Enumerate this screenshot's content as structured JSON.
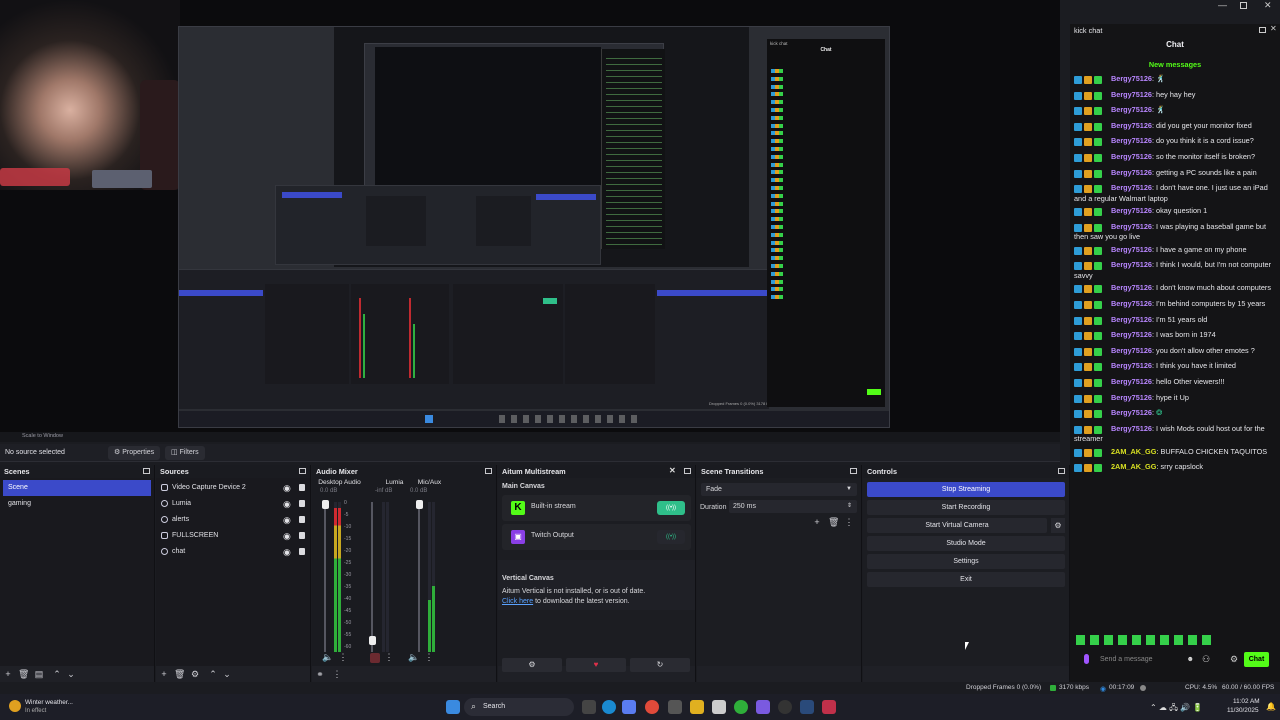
{
  "preview": {
    "scale_label": "Scale to Window",
    "nested_chat_title": "Chat",
    "nested_chat_header": "kick chat",
    "nested_status": "Dropped Frames 0 (0.0%)  3178 kbps  00:10:15  CPU 4.5%  60.00 / 60.00 FPS"
  },
  "propbar": {
    "no_source": "No source selected",
    "properties_label": "Properties",
    "filters_label": "Filters"
  },
  "scenes": {
    "title": "Scenes",
    "items": [
      {
        "label": "Scene",
        "selected": true
      },
      {
        "label": "gaming",
        "selected": false
      }
    ]
  },
  "sources": {
    "title": "Sources",
    "items": [
      {
        "label": "Video Capture Device 2"
      },
      {
        "label": "Lumia"
      },
      {
        "label": "alerts"
      },
      {
        "label": "FULLSCREEN"
      },
      {
        "label": "chat"
      }
    ]
  },
  "mixer": {
    "title": "Audio Mixer",
    "channels": [
      {
        "name": "Desktop Audio",
        "db": "0.0 dB",
        "level": 0.96,
        "level2": 0.96
      },
      {
        "name": "Lumia",
        "db": "-inf dB",
        "level": 0.0,
        "level2": 0.0
      },
      {
        "name": "Mic/Aux",
        "db": "0.0 dB",
        "level": 0.35,
        "level2": 0.44
      }
    ],
    "ticks": [
      "0",
      "-5",
      "-10",
      "-15",
      "-20",
      "-25",
      "-30",
      "-35",
      "-40",
      "-45",
      "-50",
      "-55",
      "-60"
    ]
  },
  "aitum": {
    "title": "Aitum Multistream",
    "main_canvas": "Main Canvas",
    "outputs": [
      {
        "label": "Built-in stream",
        "active": true
      },
      {
        "label": "Twitch Output",
        "active": false
      }
    ],
    "vertical_title": "Vertical Canvas",
    "vertical_text": "Aitum Vertical is not installed, or is out of date.",
    "vertical_link": "Click here",
    "vertical_link_rest": " to download the latest version."
  },
  "transitions": {
    "title": "Scene Transitions",
    "selected": "Fade",
    "duration_label": "Duration",
    "duration_value": "250 ms"
  },
  "controls": {
    "title": "Controls",
    "buttons": [
      {
        "label": "Stop Streaming",
        "active": true
      },
      {
        "label": "Start Recording",
        "active": false
      },
      {
        "label": "Start Virtual Camera",
        "active": false
      },
      {
        "label": "Studio Mode",
        "active": false
      },
      {
        "label": "Settings",
        "active": false
      },
      {
        "label": "Exit",
        "active": false
      }
    ]
  },
  "status": {
    "dropped": "Dropped Frames 0 (0.0%)",
    "kbps": "3170 kbps",
    "time": "00:17:09",
    "cpu": "CPU: 4.5%",
    "fps": "60.00 / 60.00 FPS"
  },
  "kick": {
    "window_title": "kick chat",
    "chat_title": "Chat",
    "new_messages": "New messages",
    "input_placeholder": "Send a message",
    "send_label": "Chat",
    "messages": [
      {
        "user": "Bergy75126",
        "text": "",
        "emoji": true,
        "green": false
      },
      {
        "user": "Bergy75126",
        "text": "hey hay hey",
        "green": false
      },
      {
        "user": "Bergy75126",
        "text": "",
        "emoji": true,
        "green": false
      },
      {
        "user": "Bergy75126",
        "text": "did you get your monitor fixed",
        "green": false
      },
      {
        "user": "Bergy75126",
        "text": "do you think it is a cord issue?",
        "green": false
      },
      {
        "user": "Bergy75126",
        "text": "so the monitor itself is broken?",
        "green": false
      },
      {
        "user": "Bergy75126",
        "text": "getting a PC sounds like a pain",
        "green": false
      },
      {
        "user": "Bergy75126",
        "text": "I don't have one. I just use an iPad and a regular Walmart laptop",
        "green": false
      },
      {
        "user": "Bergy75126",
        "text": "okay question 1",
        "green": false
      },
      {
        "user": "Bergy75126",
        "text": "I was playing a baseball game but then saw you go live",
        "green": false
      },
      {
        "user": "Bergy75126",
        "text": "I have a game on my phone",
        "green": false
      },
      {
        "user": "Bergy75126",
        "text": "I think I would, but I'm not computer savvy",
        "green": false
      },
      {
        "user": "Bergy75126",
        "text": "I don't know much about computers",
        "green": false
      },
      {
        "user": "Bergy75126",
        "text": "I'm behind computers by 15 years",
        "green": false
      },
      {
        "user": "Bergy75126",
        "text": "I'm 51 years old",
        "green": false
      },
      {
        "user": "Bergy75126",
        "text": "I was born in 1974",
        "green": false
      },
      {
        "user": "Bergy75126",
        "text": "you don't allow other emotes ?",
        "green": false
      },
      {
        "user": "Bergy75126",
        "text": "I think you have it limited",
        "green": false
      },
      {
        "user": "Bergy75126",
        "text": "hello Other viewers!!!",
        "green": false
      },
      {
        "user": "Bergy75126",
        "text": "hype it Up",
        "green": false
      },
      {
        "user": "Bergy75126",
        "text": "",
        "emoji": true,
        "green": false
      },
      {
        "user": "Bergy75126",
        "text": "I wish Mods could host out for the streamer",
        "green": false
      },
      {
        "user": "2AM_AK_GG",
        "text": "BUFFALO CHICKEN TAQUITOS",
        "green": true
      },
      {
        "user": "2AM_AK_GG",
        "text": "srry capslock",
        "green": true
      }
    ]
  },
  "taskbar": {
    "weather_line1": "Winter weather...",
    "weather_line2": "In effect",
    "search": "Search",
    "time": "11:02 AM",
    "date": "11/30/2025"
  },
  "colors": {
    "accent": "#3b4ac9",
    "kick_green": "#53fc18",
    "username_purple": "#b886ff",
    "username_yellow": "#d8e022"
  }
}
